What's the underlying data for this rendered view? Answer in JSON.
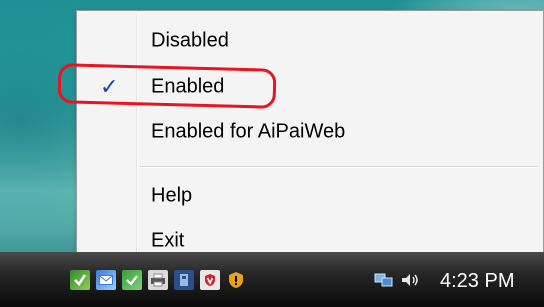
{
  "menu": {
    "items": [
      {
        "label": "Disabled",
        "checked": false
      },
      {
        "label": "Enabled",
        "checked": true
      },
      {
        "label": "Enabled for AiPaiWeb",
        "checked": false
      },
      {
        "label": "Help",
        "checked": false
      },
      {
        "label": "Exit",
        "checked": false
      }
    ],
    "check_glyph": "✓"
  },
  "taskbar": {
    "clock": "4:23 PM",
    "tray_icons": [
      "app-shield-icon",
      "mail-icon",
      "security-icon",
      "printer-icon",
      "device-icon",
      "antivirus-icon",
      "warning-shield-icon",
      "network-icon",
      "volume-icon"
    ]
  },
  "colors": {
    "annotation": "#e8141e",
    "check": "#1a3fb8"
  }
}
